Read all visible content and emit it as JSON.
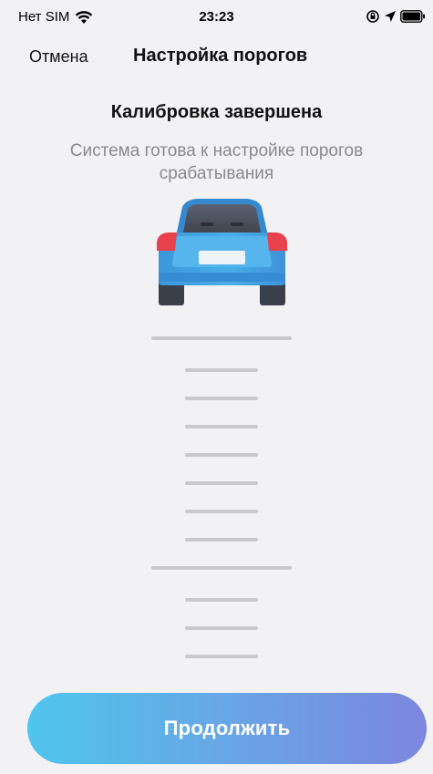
{
  "status_bar": {
    "carrier": "Нет SIM",
    "time": "23:23",
    "icons": [
      "wifi-icon",
      "orientation-lock-icon",
      "location-arrow-icon",
      "battery-icon"
    ]
  },
  "nav": {
    "cancel_label": "Отмена",
    "title": "Настройка порогов"
  },
  "main": {
    "headline": "Калибровка завершена",
    "subtitle": "Система готова к настройке порогов срабатывания"
  },
  "car": {
    "icon": "car-rear-icon",
    "body_color": "#3f9ee0",
    "light_color": "#e8424e"
  },
  "ruler": {
    "ticks": [
      "long",
      "short",
      "short",
      "short",
      "short",
      "short",
      "short",
      "short",
      "long",
      "short",
      "short",
      "short"
    ]
  },
  "actions": {
    "continue_label": "Продолжить"
  },
  "colors": {
    "background": "#f2f2f4",
    "button_gradient_start": "#4fc5ee",
    "button_gradient_end": "#7c86de",
    "subtitle": "#8a8a8e",
    "tick": "#c9c9cd"
  }
}
